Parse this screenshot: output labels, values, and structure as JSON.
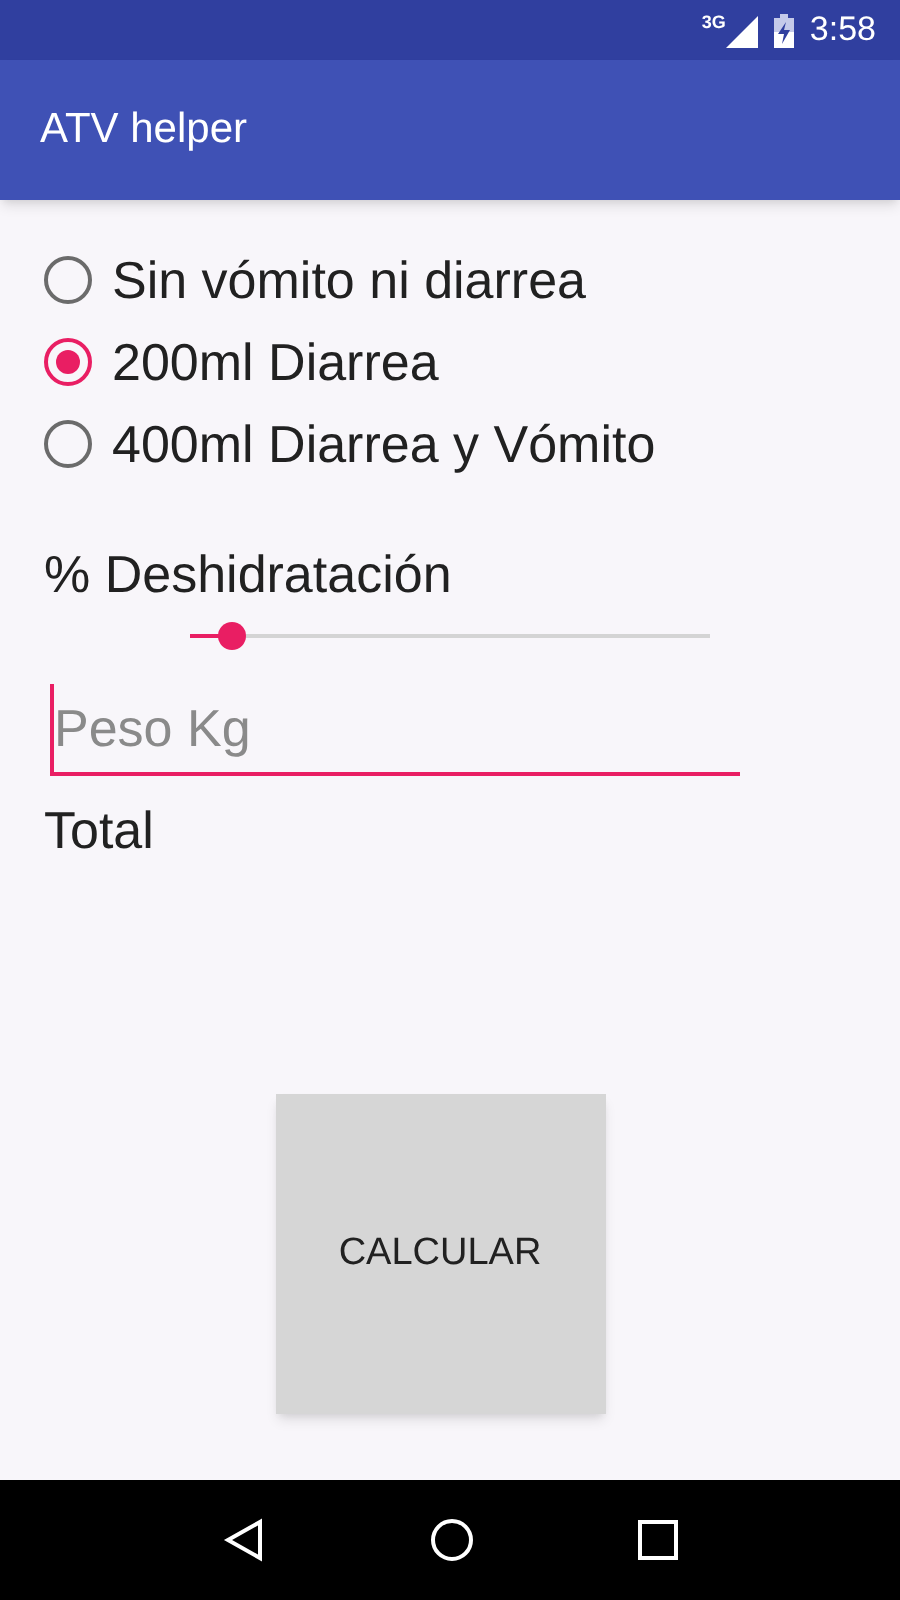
{
  "status_bar": {
    "network": "3G",
    "time": "3:58"
  },
  "app_bar": {
    "title": "ATV helper"
  },
  "options": [
    {
      "label": "Sin vómito ni diarrea",
      "selected": false
    },
    {
      "label": "200ml Diarrea",
      "selected": true
    },
    {
      "label": "400ml Diarrea y Vómito",
      "selected": false
    }
  ],
  "dehydration": {
    "label": "% Deshidratación",
    "level": 0.08
  },
  "weight_field": {
    "placeholder": "Peso Kg"
  },
  "total_label": "Total",
  "calculate_button": "CALCULAR"
}
